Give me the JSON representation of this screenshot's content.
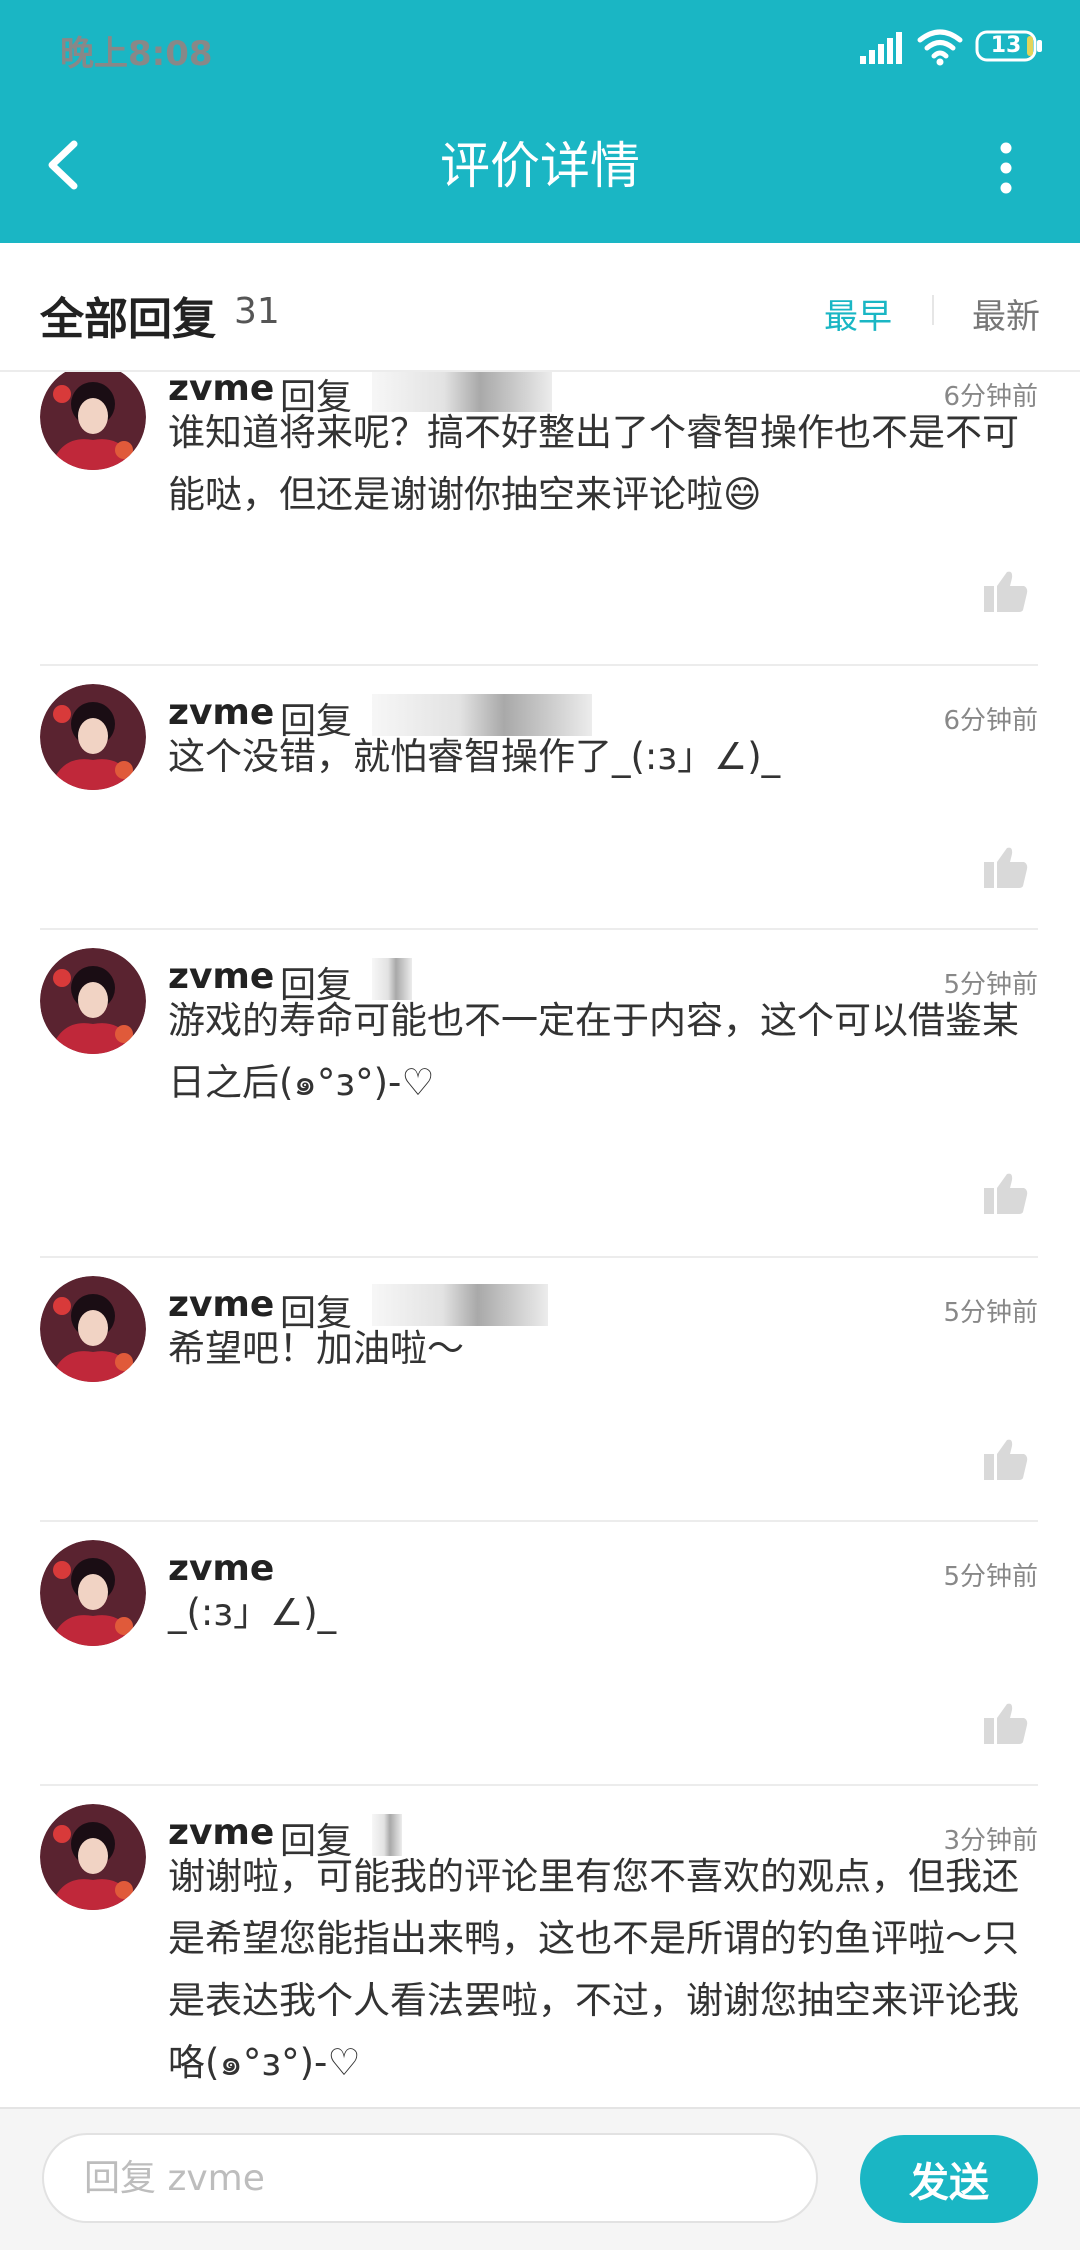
{
  "status_bar": {
    "time": "晚上8:08",
    "battery": "13"
  },
  "app_bar": {
    "title": "评价详情",
    "back_icon": "back-arrow-icon",
    "more_icon": "more-vertical-icon"
  },
  "filter": {
    "heading": "全部回复",
    "count": "31",
    "sort_oldest": "最早",
    "sort_newest": "最新"
  },
  "replies": [
    {
      "user": "zvme",
      "reply_word": "回复",
      "time": "6分钟前",
      "text": "谁知道将来呢？搞不好整出了个睿智操作也不是不可能哒，但还是谢谢你抽空来评论啦😄"
    },
    {
      "user": "zvme",
      "reply_word": "回复",
      "time": "6分钟前",
      "text": "这个没错，就怕睿智操作了_(:з」∠)_"
    },
    {
      "user": "zvme",
      "reply_word": "回复",
      "time": "5分钟前",
      "text": "游戏的寿命可能也不一定在于内容，这个可以借鉴某日之后(๑°з°)-♡"
    },
    {
      "user": "zvme",
      "reply_word": "回复",
      "time": "5分钟前",
      "text": "希望吧！加油啦～"
    },
    {
      "user": "zvme",
      "reply_word": "",
      "time": "5分钟前",
      "text": "_(:з」∠)_"
    },
    {
      "user": "zvme",
      "reply_word": "回复",
      "time": "3分钟前",
      "text": "谢谢啦，可能我的评论里有您不喜欢的观点，但我还是希望您能指出来鸭，这也不是所谓的钓鱼评啦～只是表达我个人看法罢啦，不过，谢谢您抽空来评论我咯(๑°з°)-♡"
    }
  ],
  "reply_bar": {
    "placeholder": "回复 zvme",
    "send_label": "发送"
  },
  "colors": {
    "accent": "#1ab6c4"
  }
}
